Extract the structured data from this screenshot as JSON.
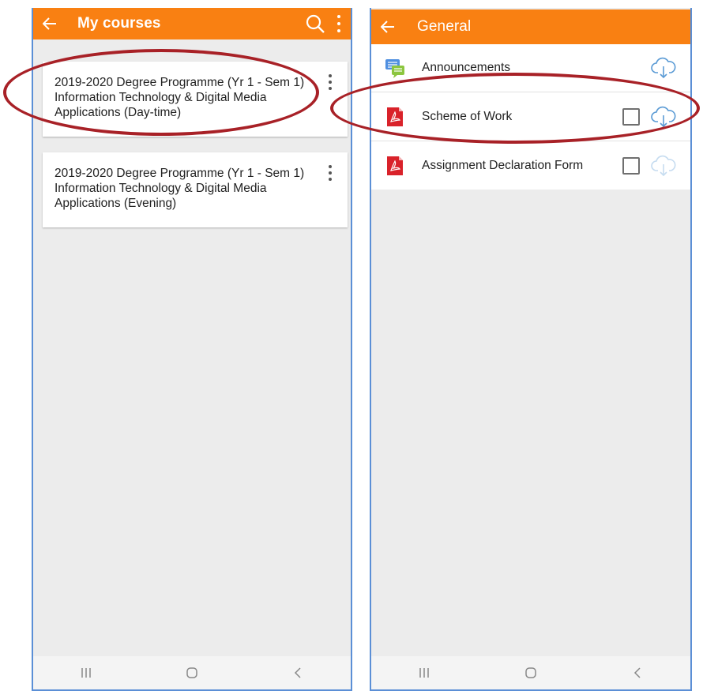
{
  "left_screen": {
    "app_bar": {
      "title": "My courses",
      "icons": [
        "back-arrow-icon",
        "search-icon",
        "kebab-menu-icon"
      ]
    },
    "courses": [
      {
        "name": "2019-2020 Degree Programme (Yr 1 - Sem 1) Information Technology & Digital Media Applications (Day-time)"
      },
      {
        "name": "2019-2020 Degree Programme (Yr 1 - Sem 1) Information Technology & Digital Media Applications (Evening)"
      }
    ],
    "nav_bar": [
      "recent-apps-icon",
      "home-icon",
      "back-icon"
    ]
  },
  "right_screen": {
    "app_bar": {
      "title": "General",
      "icons": [
        "back-arrow-icon"
      ]
    },
    "items": [
      {
        "label": "Announcements",
        "icon": "forum-icon",
        "has_checkbox": false,
        "cloud": "active"
      },
      {
        "label": "Scheme of Work",
        "icon": "pdf-icon",
        "has_checkbox": true,
        "cloud": "active"
      },
      {
        "label": "Assignment Declaration Form",
        "icon": "pdf-icon",
        "has_checkbox": true,
        "cloud": "faded"
      }
    ],
    "nav_bar": [
      "recent-apps-icon",
      "home-icon",
      "back-icon"
    ]
  },
  "colors": {
    "accent": "#f98012",
    "highlight": "#a82127",
    "background": "#ececec",
    "frame": "#5b8fd6"
  }
}
